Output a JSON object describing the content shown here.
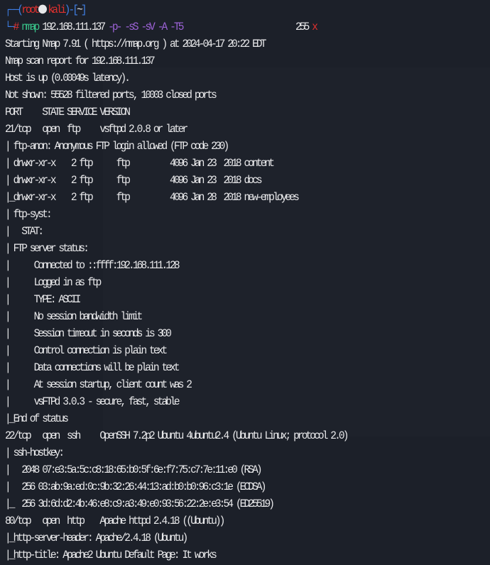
{
  "prompt": {
    "user": "root",
    "host": "kali",
    "cwd": "~",
    "symbol": "#",
    "command": "nmap",
    "target": "192.168.111.137",
    "flags": "-p- -sS -sV -A -T5",
    "exit_code": "255",
    "exit_icon": "x"
  },
  "output": [
    "Starting Nmap 7.91 ( https://nmap.org ) at 2024-04-17 20:22 EDT",
    "Nmap scan report for 192.168.111.137",
    "Host is up (0.00049s latency).",
    "Not shown: 55528 filtered ports, 10003 closed ports",
    "PORT     STATE SERVICE VERSION",
    "21/tcp   open  ftp     vsftpd 2.0.8 or later",
    "| ftp-anon: Anonymous FTP login allowed (FTP code 230)",
    "| drwxr-xr-x    2 ftp      ftp          4096 Jan 23  2018 content",
    "| drwxr-xr-x    2 ftp      ftp          4096 Jan 23  2018 docs",
    "|_drwxr-xr-x    2 ftp      ftp          4096 Jan 28  2018 new-employees",
    "| ftp-syst:",
    "|   STAT:",
    "| FTP server status:",
    "|      Connected to ::ffff:192.168.111.128",
    "|      Logged in as ftp",
    "|      TYPE: ASCII",
    "|      No session bandwidth limit",
    "|      Session timeout in seconds is 300",
    "|      Control connection is plain text",
    "|      Data connections will be plain text",
    "|      At session startup, client count was 2",
    "|      vsFTPd 3.0.3 - secure, fast, stable",
    "|_End of status",
    "22/tcp   open  ssh     OpenSSH 7.2p2 Ubuntu 4ubuntu2.4 (Ubuntu Linux; protocol 2.0)",
    "| ssh-hostkey:",
    "|   2048 07:e3:5a:5c:c8:18:65:b0:5f:6e:f7:75:c7:7e:11:e0 (RSA)",
    "|   256 03:ab:9a:ed:0c:9b:32:26:44:13:ad:b0:b0:96:c3:1e (ECDSA)",
    "|_  256 3d:6d:d2:4b:46:e8:c9:a3:49:e0:93:56:22:2e:e3:54 (ED25519)",
    "80/tcp   open  http    Apache httpd 2.4.18 ((Ubuntu))",
    "|_http-server-header: Apache/2.4.18 (Ubuntu)",
    "|_http-title: Apache2 Ubuntu Default Page: It works"
  ],
  "colors": {
    "background": "#1c2029",
    "prompt_frame": "#3f7fe6",
    "user": "#e0312f",
    "command": "#39c48a",
    "flags": "#9c62d6"
  }
}
